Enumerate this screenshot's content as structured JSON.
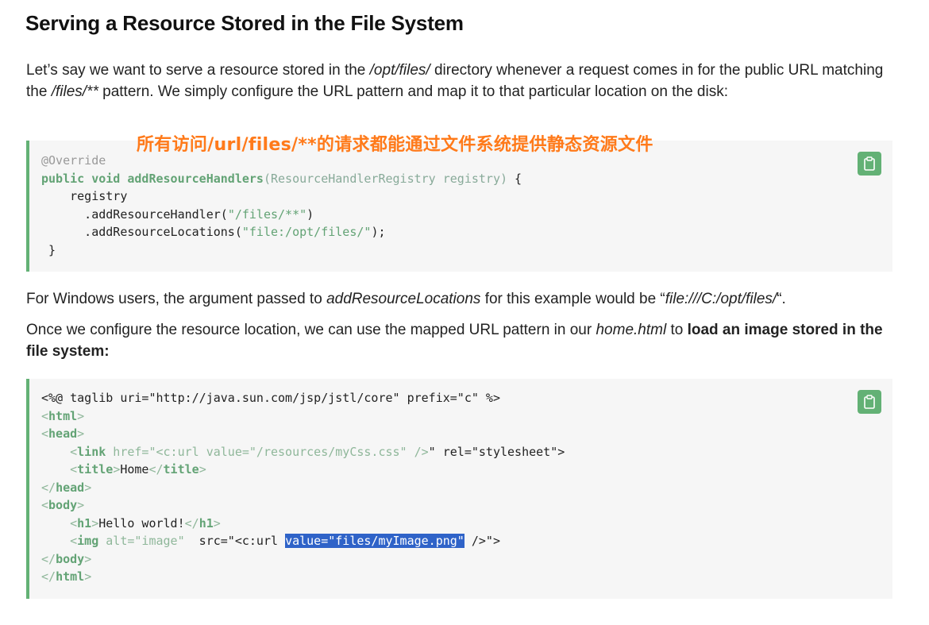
{
  "heading": "Serving a Resource Stored in the File System",
  "para1": {
    "t1": "Let’s say we want to serve a resource stored in the ",
    "e1": "/opt/files/",
    "t2": " directory whenever a request comes in for the public URL matching the ",
    "e2": "/files/**",
    "t3": " pattern. We simply configure the URL pattern and map it to that particular location on the disk:"
  },
  "annotation": "所有访问/url/files/**的请求都能通过文件系统提供静态资源文件",
  "code1": {
    "l1_ann": "@Override",
    "l2_kw": "public void ",
    "l2_fn": "addResourceHandlers",
    "l2_params": "(ResourceHandlerRegistry registry)",
    "l2_brace": " {",
    "l3": "    registry",
    "l4_a": "      .addResourceHandler(",
    "l4_s": "\"/files/**\"",
    "l4_b": ")",
    "l5_a": "      .addResourceLocations(",
    "l5_s": "\"file:/opt/files/\"",
    "l5_b": ");",
    "l6": " }"
  },
  "para2": {
    "t1": "For Windows users, the argument passed to ",
    "e1": "addResourceLocations",
    "t2": " for this example would be “",
    "e2": "file:///C:/opt/files/",
    "t3": "“."
  },
  "para3": {
    "t1": "Once we configure the resource location, we can use the mapped URL pattern in our ",
    "e1": "home.html",
    "t2": " to ",
    "b1": "load an image stored in the file system:"
  },
  "code2": {
    "l1": "<%@ taglib uri=\"http://java.sun.com/jsp/jstl/core\" prefix=\"c\" %>",
    "l2_tag": "html",
    "l3_tag": "head",
    "l4_tag": "link",
    "l4_attr": " href=\"<c:url value=\"/resources/myCss.css\" />",
    "l4_rest": "\" rel=\"stylesheet\">",
    "l5_tag": "title",
    "l5_text": "Home",
    "l6_tag": "head",
    "l7_tag": "body",
    "l8_tag": "h1",
    "l8_text": "Hello world!",
    "l9_tag": "img",
    "l9_attr": " alt=\"image\"",
    "l9_rest": "  src=\"<c:url ",
    "l9_hl": "value=\"files/myImage.png\"",
    "l9_end": " />\">",
    "l10_tag": "body",
    "l11_tag": "html"
  },
  "colors": {
    "accent_green": "#63b175",
    "annotation_orange": "#ff7a1a",
    "selection_blue": "#2f63c8"
  },
  "icons": {
    "copy": "clipboard-icon"
  }
}
